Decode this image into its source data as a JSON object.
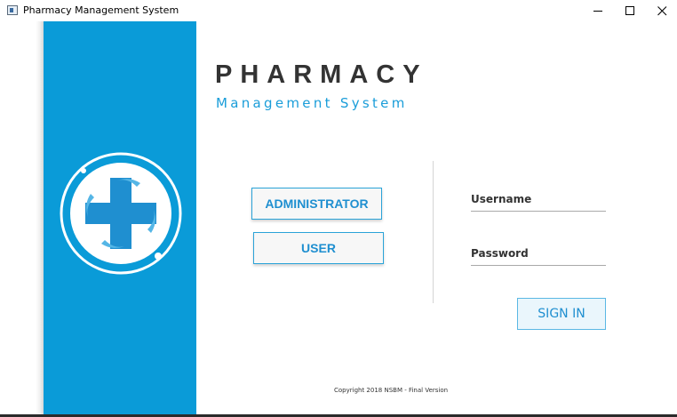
{
  "window": {
    "title": "Pharmacy Management System"
  },
  "brand": {
    "title": "PHARMACY",
    "subtitle": "Management System"
  },
  "roles": {
    "admin_label": "ADMINISTRATOR",
    "user_label": "USER"
  },
  "login": {
    "username_label": "Username",
    "password_label": "Password",
    "username_value": "",
    "password_value": "",
    "signin_label": "SIGN IN"
  },
  "footer": {
    "copyright": "Copyright 2018 NSBM - Final Version"
  },
  "colors": {
    "panel_blue": "#0a9bd8",
    "accent_blue": "#1f8fd0",
    "title_dark": "#333333"
  },
  "icons": {
    "app": "app-window-icon",
    "logo": "medical-cross-logo-icon",
    "minimize": "minimize-icon",
    "maximize": "maximize-icon",
    "close": "close-icon"
  }
}
